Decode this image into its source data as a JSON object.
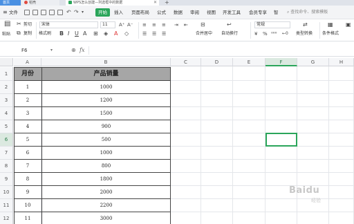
{
  "tabs": [
    {
      "label": "首页"
    },
    {
      "label": "稻壳"
    },
    {
      "label": "WPS怎么创建—列选框中的数据"
    }
  ],
  "menu": {
    "items": [
      "文件",
      "开始",
      "插入",
      "页面布局",
      "公式",
      "数据",
      "审阅",
      "视图",
      "开发工具",
      "会员专享",
      "智"
    ],
    "active": "开始",
    "search_placeholder": "查找命令、搜索模板"
  },
  "ribbon": {
    "paste": "粘贴",
    "cut": "剪切",
    "copy": "复制",
    "format_painter": "格式刷",
    "font_name": "宋体",
    "font_size": "11",
    "merge_center": "合并居中",
    "wrap_text": "自动换行",
    "number_format": "常规",
    "type_convert": "类型转换",
    "cond_format": "条件格式"
  },
  "formula_bar": {
    "cell_ref": "F6",
    "fx": "fx",
    "formula": ""
  },
  "sheet": {
    "columns": [
      "A",
      "B",
      "C",
      "D",
      "E",
      "F",
      "G",
      "H"
    ],
    "rows": [
      "1",
      "2",
      "3",
      "4",
      "5",
      "6",
      "7",
      "8",
      "9",
      "10",
      "11",
      "12"
    ],
    "selected_column": "F",
    "selected_row": "6",
    "table": {
      "header": [
        "月份",
        "产品销量"
      ],
      "rows": [
        [
          "1",
          "1000"
        ],
        [
          "2",
          "1200"
        ],
        [
          "3",
          "1500"
        ],
        [
          "4",
          "900"
        ],
        [
          "5",
          "500"
        ],
        [
          "6",
          "1000"
        ],
        [
          "7",
          "800"
        ],
        [
          "8",
          "1800"
        ],
        [
          "9",
          "2000"
        ],
        [
          "10",
          "2200"
        ],
        [
          "11",
          "3000"
        ]
      ]
    }
  },
  "watermark": {
    "text": "Baidu",
    "sub": "经验"
  },
  "colors": {
    "accent": "#2aa55a",
    "header_fill": "#a6a6a6"
  }
}
